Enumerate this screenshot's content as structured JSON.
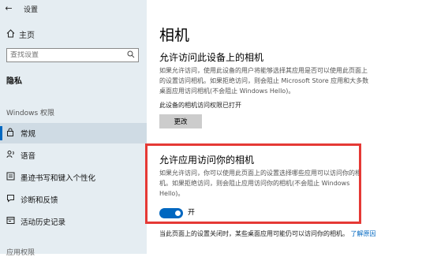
{
  "window": {
    "title": "设置",
    "back_icon": "back-arrow-icon"
  },
  "sidebar": {
    "home_label": "主页",
    "search_placeholder": "查找设置",
    "section_title": "隐私",
    "group_title": "Windows 权限",
    "items": [
      {
        "label": "常规",
        "icon": "lock-icon",
        "active": true
      },
      {
        "label": "语音",
        "icon": "voice-icon",
        "active": false
      },
      {
        "label": "墨迹书写和键入个性化",
        "icon": "handwriting-icon",
        "active": false
      },
      {
        "label": "诊断和反馈",
        "icon": "feedback-icon",
        "active": false
      },
      {
        "label": "活动历史记录",
        "icon": "history-icon",
        "active": false
      }
    ],
    "partial_group_title": "应用权限"
  },
  "main": {
    "page_title": "相机",
    "device_section": {
      "title": "允许访问此设备上的相机",
      "description": "如果允许访问，使用此设备的用户将能够选择其应用是否可以使用此页面上的设置访问相机。如果拒绝访问，则会阻止 Microsoft Store 应用和大多数桌面应用访问相机(不会阻止 Windows Hello)。",
      "status_text": "此设备的相机访问权限已打开",
      "change_button": "更改"
    },
    "app_section": {
      "title": "允许应用访问你的相机",
      "description": "如果允许访问，你可以使用此页面上的设置选择哪些应用可以访问你的相机。如果拒绝访问，则会阻止应用访问你的相机(不会阻止 Windows Hello)。",
      "toggle_state": "开",
      "toggle_on": true
    },
    "footer_text": "当此页面上的设置关闭时，某些桌面应用可能仍可以访问你的相机。",
    "learn_more_link": "了解原因"
  },
  "colors": {
    "accent": "#0067c0",
    "highlight_border": "#e53935",
    "sidebar_bg": "#e5edf2"
  }
}
